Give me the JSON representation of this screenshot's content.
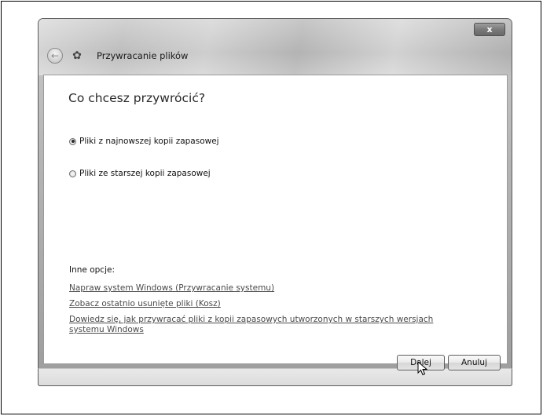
{
  "window": {
    "title": "Przywracanie plików",
    "close_glyph": "x"
  },
  "icons": {
    "back": "back-arrow-icon",
    "app": "restore-files-icon",
    "close": "close-icon"
  },
  "content": {
    "heading": "Co chcesz przywrócić?",
    "options": [
      {
        "label": "Pliki z najnowszej kopii zapasowej",
        "checked": true
      },
      {
        "label": "Pliki ze starszej kopii zapasowej",
        "checked": false
      }
    ],
    "other_options_label": "Inne opcje:",
    "links": [
      "Napraw system Windows (Przywracanie systemu)",
      "Zobacz ostatnio usunięte pliki (Kosz)",
      "Dowiedz się, jak przywracać pliki z kopii zapasowych utworzonych w starszych wersjach systemu Windows"
    ]
  },
  "buttons": {
    "next": "Dalej",
    "cancel": "Anuluj"
  }
}
